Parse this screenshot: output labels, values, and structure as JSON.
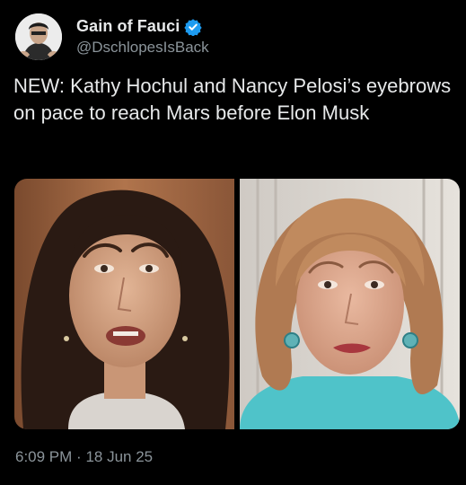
{
  "author": {
    "display_name": "Gain of Fauci",
    "handle": "@DschlopesIsBack",
    "verified": true
  },
  "tweet": {
    "text": "NEW: Kathy Hochul and Nancy Pelosi’s eyebrows on pace to reach Mars before Elon Musk"
  },
  "meta": {
    "time": "6:09 PM",
    "separator": "·",
    "date": "18 Jun 25"
  },
  "colors": {
    "background": "#000000",
    "text": "#e7e9ea",
    "secondary": "#8b949a",
    "verified": "#1d9bf0"
  }
}
